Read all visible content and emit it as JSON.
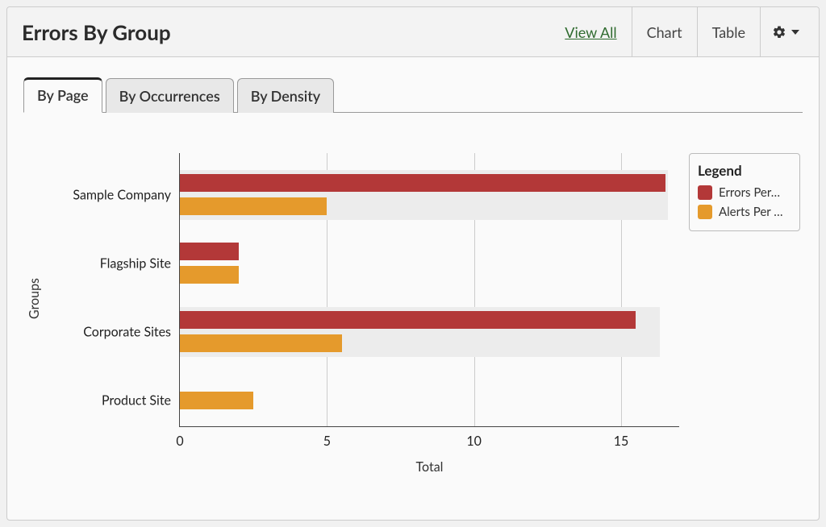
{
  "header": {
    "title": "Errors By Group",
    "view_all": "View All",
    "chart_btn": "Chart",
    "table_btn": "Table"
  },
  "tabs": [
    {
      "label": "By Page"
    },
    {
      "label": "By Occurrences"
    },
    {
      "label": "By Density"
    }
  ],
  "axis": {
    "ytitle": "Groups",
    "xtitle": "Total",
    "xticks": [
      "0",
      "5",
      "10",
      "15"
    ]
  },
  "legend": {
    "title": "Legend",
    "errors": "Errors Per…",
    "alerts": "Alerts Per …"
  },
  "chart_data": {
    "type": "bar",
    "orientation": "horizontal",
    "title": "Errors By Group",
    "xlabel": "Total",
    "ylabel": "Groups",
    "xlim": [
      0,
      17
    ],
    "xticks": [
      0,
      5,
      10,
      15
    ],
    "categories": [
      "Sample Company",
      "Flagship Site",
      "Corporate Sites",
      "Product Site"
    ],
    "series": [
      {
        "name": "Errors Per Page",
        "color": "#b33838",
        "values": [
          16.5,
          2,
          15.5,
          0
        ]
      },
      {
        "name": "Alerts Per Page",
        "color": "#e59a2c",
        "values": [
          5,
          2,
          5.5,
          2.5
        ]
      }
    ],
    "legend_position": "right"
  }
}
